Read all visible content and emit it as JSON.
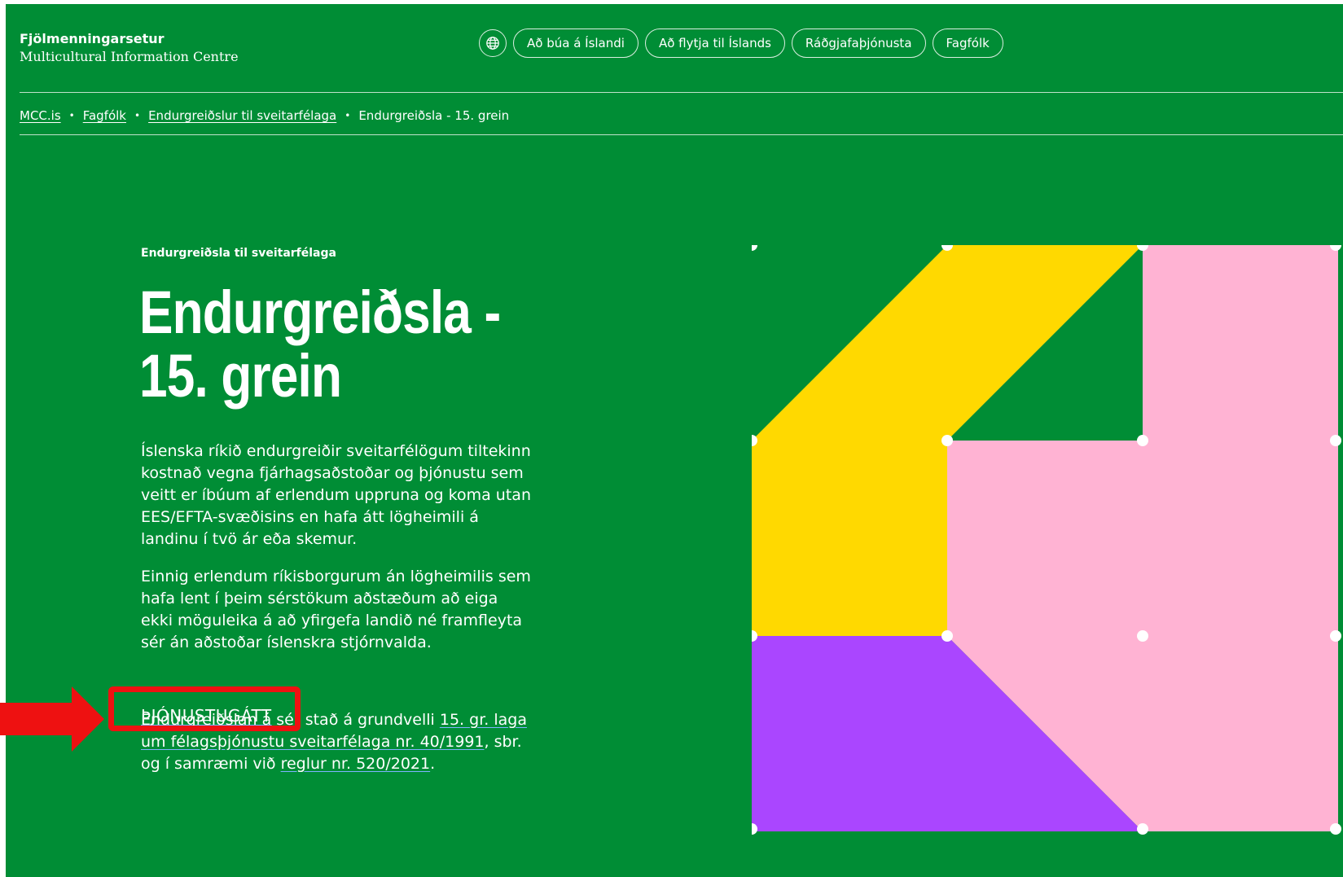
{
  "header": {
    "logo_title": "Fjölmenningarsetur",
    "logo_subtitle": "Multicultural Information Centre",
    "language_icon": "globe-icon",
    "nav": [
      {
        "label": "Að búa á Íslandi"
      },
      {
        "label": "Að flytja til Íslands"
      },
      {
        "label": "Ráðgjafaþjónusta"
      },
      {
        "label": "Fagfólk"
      }
    ]
  },
  "breadcrumb": {
    "items": [
      "MCC.is",
      "Fagfólk",
      "Endurgreiðslur til sveitarfélaga"
    ],
    "current": "Endurgreiðsla - 15. grein",
    "separator": "•"
  },
  "main": {
    "eyebrow": "Endurgreiðsla til sveitarfélaga",
    "title_line1": "Endurgreiðsla -",
    "title_line2": "15. grein",
    "paragraph1": "Íslenska ríkið endurgreiðir sveitarfélögum tiltekinn kostnað vegna fjárhagsaðstoðar og þjónustu sem veitt er íbúum af erlendum uppruna og koma utan EES/EFTA-svæðisins en hafa átt lögheimili á landinu í tvö ár eða skemur.",
    "paragraph2": "Einnig erlendum ríkisborgurum án lögheimilis sem hafa lent í þeim sérstökum aðstæðum að eiga ekki möguleika á að yfirgefa landið né framfleyta sér án aðstoðar íslenskra stjórnvalda.",
    "service_link": "ÞJÓNUSTUGÁTT",
    "paragraph3_start": "Endurgreiðslan á sér stað á grundvelli ",
    "paragraph3_link1": "15. gr. laga um félagsþjónustu sveitarfélaga nr. 40/1991",
    "paragraph3_mid": ", sbr. og í samræmi við ",
    "paragraph3_link2": "reglur nr. 520/2021",
    "paragraph3_end": "."
  },
  "colors": {
    "background": "#008d35",
    "yellow": "#ffd900",
    "pink": "#ffb3d3",
    "purple": "#aa46ff",
    "annotation": "#ee1111"
  }
}
